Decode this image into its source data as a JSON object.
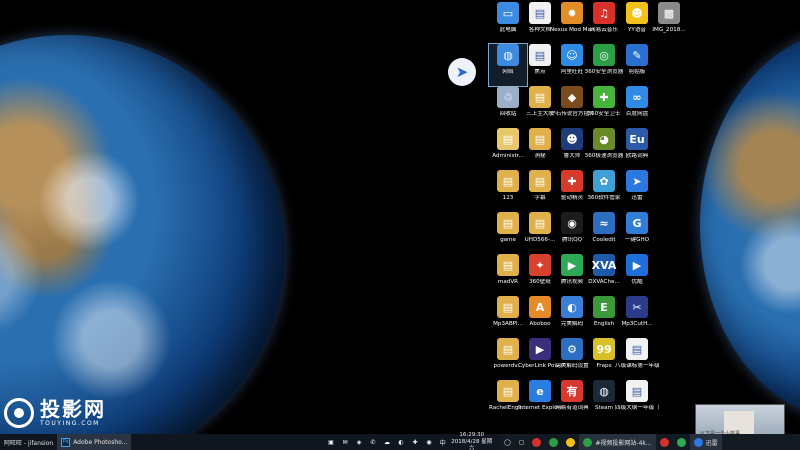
{
  "desktop": {
    "icons": [
      {
        "label": "此电脑",
        "color": "#3d8be0",
        "glyph": "▭",
        "col": 0,
        "row": 0
      },
      {
        "label": "网络",
        "color": "#3d8be0",
        "glyph": "◍",
        "col": 0,
        "row": 1,
        "selected": true
      },
      {
        "label": "回收站",
        "color": "#9ab0c8",
        "glyph": "♲",
        "col": 0,
        "row": 2
      },
      {
        "label": "Administr...",
        "color": "#e9c86a",
        "glyph": "▤",
        "col": 0,
        "row": 3
      },
      {
        "label": "123",
        "color": "#e0b04a",
        "glyph": "▤",
        "col": 0,
        "row": 4
      },
      {
        "label": "game",
        "color": "#e0b04a",
        "glyph": "▤",
        "col": 0,
        "row": 5
      },
      {
        "label": "madVR",
        "color": "#e0b04a",
        "glyph": "▤",
        "col": 0,
        "row": 6
      },
      {
        "label": "Mp3ABPl...",
        "color": "#e0b04a",
        "glyph": "▤",
        "col": 0,
        "row": 7
      },
      {
        "label": "powerdv...",
        "color": "#e0b04a",
        "glyph": "▤",
        "col": 0,
        "row": 8
      },
      {
        "label": "RachelEngli...",
        "color": "#e0b04a",
        "glyph": "▤",
        "col": 0,
        "row": 9
      },
      {
        "label": "各种文档",
        "color": "#f0f0f0",
        "glyph": "▤",
        "col": 1,
        "row": 0
      },
      {
        "label": "焦点",
        "color": "#f0f0f0",
        "glyph": "▤",
        "col": 1,
        "row": 1
      },
      {
        "label": "三上主大阳",
        "color": "#e0b04a",
        "glyph": "▤",
        "col": 1,
        "row": 2
      },
      {
        "label": "洞秘",
        "color": "#e0b04a",
        "glyph": "▤",
        "col": 1,
        "row": 3
      },
      {
        "label": "字幕",
        "color": "#e0b04a",
        "glyph": "▤",
        "col": 1,
        "row": 4
      },
      {
        "label": "UHD566-...",
        "color": "#e0b04a",
        "glyph": "▤",
        "col": 1,
        "row": 5
      },
      {
        "label": "360壁纸",
        "color": "#d9412f",
        "glyph": "✦",
        "col": 1,
        "row": 6
      },
      {
        "label": "Aboboo",
        "color": "#e78a2a",
        "glyph": "A",
        "col": 1,
        "row": 7
      },
      {
        "label": "CyberLink PowerDV...",
        "color": "#3a2f7a",
        "glyph": "▶",
        "col": 1,
        "row": 8
      },
      {
        "label": "Internet Explorer",
        "color": "#2a7de0",
        "glyph": "e",
        "col": 1,
        "row": 9
      },
      {
        "label": "Nexus Mod Manager",
        "color": "#e48c26",
        "glyph": "✹",
        "col": 2,
        "row": 0
      },
      {
        "label": "阿里旺旺",
        "color": "#2d8be6",
        "glyph": "☺",
        "col": 2,
        "row": 1
      },
      {
        "label": "炉石传说官方插件",
        "color": "#7a4b1c",
        "glyph": "◆",
        "col": 2,
        "row": 2
      },
      {
        "label": "鲁大师",
        "color": "#1e3c7a",
        "glyph": "☻",
        "col": 2,
        "row": 3
      },
      {
        "label": "驱动精灵",
        "color": "#d93a2a",
        "glyph": "✚",
        "col": 2,
        "row": 4
      },
      {
        "label": "腾讯QQ",
        "color": "#1b1b1b",
        "glyph": "◉",
        "col": 2,
        "row": 5
      },
      {
        "label": "腾讯视频",
        "color": "#2eaa56",
        "glyph": "▶",
        "col": 2,
        "row": 6
      },
      {
        "label": "完美解码",
        "color": "#3a7fd6",
        "glyph": "◐",
        "col": 2,
        "row": 7
      },
      {
        "label": "完美解码设置",
        "color": "#2c6fc2",
        "glyph": "⚙",
        "col": 2,
        "row": 8
      },
      {
        "label": "网易有道词典",
        "color": "#d8382f",
        "glyph": "有",
        "col": 2,
        "row": 9
      },
      {
        "label": "网易云音乐",
        "color": "#d8312a",
        "glyph": "♫",
        "col": 3,
        "row": 0
      },
      {
        "label": "360安全浏览器",
        "color": "#2a9d45",
        "glyph": "◎",
        "col": 3,
        "row": 1
      },
      {
        "label": "360安全卫士",
        "color": "#46b33a",
        "glyph": "✚",
        "col": 3,
        "row": 2
      },
      {
        "label": "360极速浏览器",
        "color": "#6a8a2a",
        "glyph": "◕",
        "col": 3,
        "row": 3
      },
      {
        "label": "360软件管家",
        "color": "#3fa0d8",
        "glyph": "✿",
        "col": 3,
        "row": 4
      },
      {
        "label": "Cooledit",
        "color": "#2c6fc2",
        "glyph": "≈",
        "col": 3,
        "row": 5
      },
      {
        "label": "DXVAChe...",
        "color": "#1e5aa8",
        "glyph": "XVA",
        "col": 3,
        "row": 6
      },
      {
        "label": "English",
        "color": "#3a9a3a",
        "glyph": "E",
        "col": 3,
        "row": 7
      },
      {
        "label": "Fraps",
        "color": "#d8c02a",
        "glyph": "99",
        "col": 3,
        "row": 8
      },
      {
        "label": "Steam",
        "color": "#1b2838",
        "glyph": "◍",
        "col": 3,
        "row": 9
      },
      {
        "label": "YY语音",
        "color": "#f2c21a",
        "glyph": "☻",
        "col": 4,
        "row": 0
      },
      {
        "label": "剪贴板",
        "color": "#2a6fd0",
        "glyph": "✎",
        "col": 4,
        "row": 1
      },
      {
        "label": "百度网盘",
        "color": "#2f8be6",
        "glyph": "∞",
        "col": 4,
        "row": 2
      },
      {
        "label": "欧路词典",
        "color": "#2a5aa8",
        "glyph": "Eu",
        "col": 4,
        "row": 3
      },
      {
        "label": "迅雷",
        "color": "#2a78e0",
        "glyph": "➤",
        "col": 4,
        "row": 4
      },
      {
        "label": "一键GHO",
        "color": "#2f7dd6",
        "glyph": "G",
        "col": 4,
        "row": 5
      },
      {
        "label": "优酷",
        "color": "#1e6fd8",
        "glyph": "▶",
        "col": 4,
        "row": 6
      },
      {
        "label": "Mp3CutH...",
        "color": "#2a3c8a",
        "glyph": "✂",
        "col": 4,
        "row": 7
      },
      {
        "label": "八级课标第一年级（下）...",
        "color": "#f2f2f2",
        "glyph": "▤",
        "col": 4,
        "row": 8
      },
      {
        "label": "四级大纲一年级（下）.md",
        "color": "#f2f2f2",
        "glyph": "▤",
        "col": 4,
        "row": 9
      },
      {
        "label": "IMG_2018...",
        "color": "#8a8a8a",
        "glyph": "▩",
        "col": 5,
        "row": 0
      }
    ]
  },
  "watermark": {
    "title": "投影网",
    "subtitle": "TOUYING.COM"
  },
  "thumbnail": {
    "caption": "以下是一个小故事"
  },
  "taskbar_left": {
    "items": [
      {
        "label": "阿旺旺 - jifansion",
        "active": false
      },
      {
        "label": "Adobe Photosho...",
        "active": true,
        "badge": "Ps"
      }
    ]
  },
  "taskbar_mid": {
    "tray_icons": [
      "▣",
      "✉",
      "◈",
      "✆",
      "☁",
      "◐",
      "✚",
      "◉"
    ],
    "ime": "中",
    "time": "16:29:30",
    "date": "2018/4/28 星期六"
  },
  "taskbar_right": {
    "items": [
      {
        "label": "◯",
        "color": "#ffffff"
      },
      {
        "label": "▢",
        "color": "#ffffff"
      },
      {
        "label": "",
        "color": "#d8312a",
        "round": true
      },
      {
        "label": "",
        "color": "#2a9d45",
        "round": true
      },
      {
        "label": "",
        "color": "#f2c21a",
        "round": true
      },
      {
        "label": "#视频投影网站-4k...",
        "color": "#2ea043",
        "active": true
      },
      {
        "label": "",
        "color": "#d8312a",
        "round": true
      },
      {
        "label": "",
        "color": "#2eaa56",
        "round": true
      },
      {
        "label": "迅雷",
        "color": "#2a78e0",
        "active": true
      }
    ]
  }
}
